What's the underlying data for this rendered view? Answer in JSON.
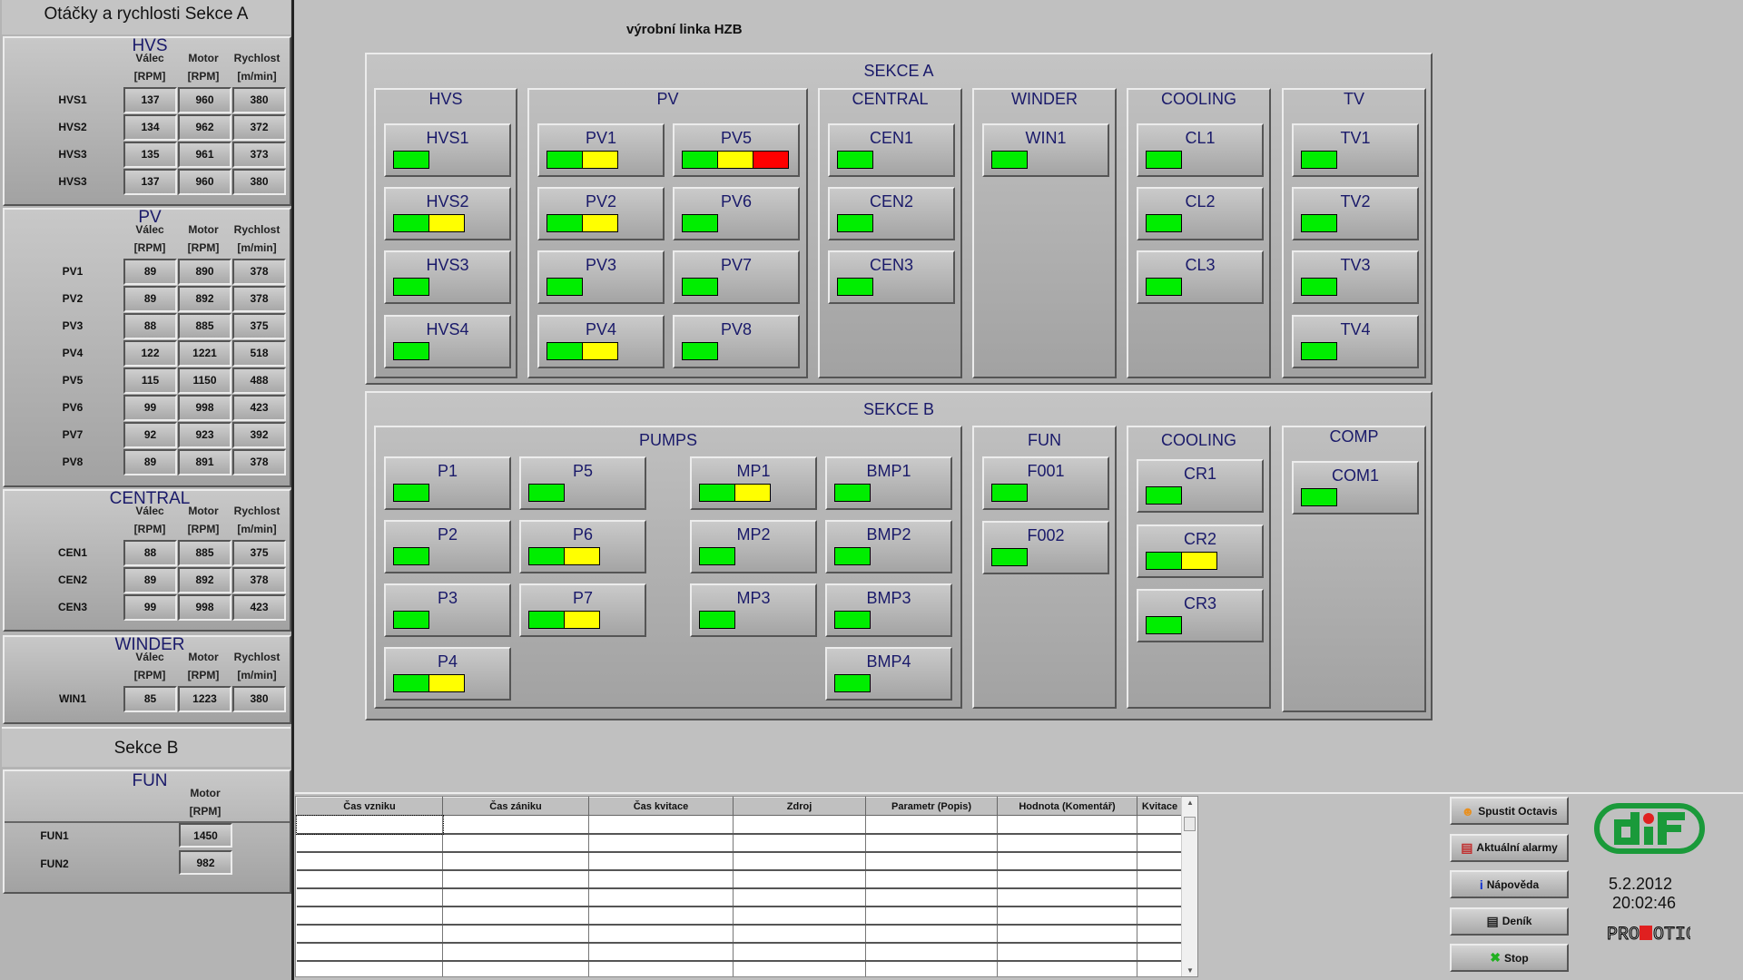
{
  "left_panel": {
    "title": "Otáčky a rychlosti Sekce A",
    "headers": {
      "valec": [
        "Válec",
        "[RPM]"
      ],
      "motor": [
        "Motor",
        "[RPM]"
      ],
      "rychlost": [
        "Rychlost",
        "[m/min]"
      ]
    },
    "sections": [
      {
        "title": "HVS",
        "rows": [
          {
            "name": "HVS1",
            "valec": "137",
            "motor": "960",
            "rychlost": "380"
          },
          {
            "name": "HVS2",
            "valec": "134",
            "motor": "962",
            "rychlost": "372"
          },
          {
            "name": "HVS3",
            "valec": "135",
            "motor": "961",
            "rychlost": "373"
          },
          {
            "name": "HVS3",
            "valec": "137",
            "motor": "960",
            "rychlost": "380"
          }
        ]
      },
      {
        "title": "PV",
        "rows": [
          {
            "name": "PV1",
            "valec": "89",
            "motor": "890",
            "rychlost": "378"
          },
          {
            "name": "PV2",
            "valec": "89",
            "motor": "892",
            "rychlost": "378"
          },
          {
            "name": "PV3",
            "valec": "88",
            "motor": "885",
            "rychlost": "375"
          },
          {
            "name": "PV4",
            "valec": "122",
            "motor": "1221",
            "rychlost": "518"
          },
          {
            "name": "PV5",
            "valec": "115",
            "motor": "1150",
            "rychlost": "488"
          },
          {
            "name": "PV6",
            "valec": "99",
            "motor": "998",
            "rychlost": "423"
          },
          {
            "name": "PV7",
            "valec": "92",
            "motor": "923",
            "rychlost": "392"
          },
          {
            "name": "PV8",
            "valec": "89",
            "motor": "891",
            "rychlost": "378"
          }
        ]
      },
      {
        "title": "CENTRAL",
        "rows": [
          {
            "name": "CEN1",
            "valec": "88",
            "motor": "885",
            "rychlost": "375"
          },
          {
            "name": "CEN2",
            "valec": "89",
            "motor": "892",
            "rychlost": "378"
          },
          {
            "name": "CEN3",
            "valec": "99",
            "motor": "998",
            "rychlost": "423"
          }
        ]
      },
      {
        "title": "WINDER",
        "rows": [
          {
            "name": "WIN1",
            "valec": "85",
            "motor": "1223",
            "rychlost": "380"
          }
        ]
      }
    ],
    "sekce_b_title": "Sekce B",
    "fun": {
      "title": "FUN",
      "header": [
        "Motor",
        "[RPM]"
      ],
      "rows": [
        {
          "name": "FUN1",
          "motor": "1450"
        },
        {
          "name": "FUN2",
          "motor": "982"
        }
      ]
    }
  },
  "main": {
    "title": "výrobní linka HZB",
    "status_colors": {
      "g": "#00ee00",
      "y": "#ffff00",
      "r": "#ff0000"
    },
    "sekce": [
      {
        "title": "SEKCE A",
        "groups": [
          {
            "title": "HVS",
            "columns": [
              [
                {
                  "label": "HVS1",
                  "status": [
                    "g"
                  ]
                },
                {
                  "label": "HVS2",
                  "status": [
                    "g",
                    "y"
                  ]
                },
                {
                  "label": "HVS3",
                  "status": [
                    "g"
                  ]
                },
                {
                  "label": "HVS4",
                  "status": [
                    "g"
                  ]
                }
              ]
            ]
          },
          {
            "title": "PV",
            "columns": [
              [
                {
                  "label": "PV1",
                  "status": [
                    "g",
                    "y"
                  ]
                },
                {
                  "label": "PV2",
                  "status": [
                    "g",
                    "y"
                  ]
                },
                {
                  "label": "PV3",
                  "status": [
                    "g"
                  ]
                },
                {
                  "label": "PV4",
                  "status": [
                    "g",
                    "y"
                  ]
                }
              ],
              [
                {
                  "label": "PV5",
                  "status": [
                    "g",
                    "y",
                    "r"
                  ]
                },
                {
                  "label": "PV6",
                  "status": [
                    "g"
                  ]
                },
                {
                  "label": "PV7",
                  "status": [
                    "g"
                  ]
                },
                {
                  "label": "PV8",
                  "status": [
                    "g"
                  ]
                }
              ]
            ]
          },
          {
            "title": "CENTRAL",
            "columns": [
              [
                {
                  "label": "CEN1",
                  "status": [
                    "g"
                  ]
                },
                {
                  "label": "CEN2",
                  "status": [
                    "g"
                  ]
                },
                {
                  "label": "CEN3",
                  "status": [
                    "g"
                  ]
                }
              ]
            ]
          },
          {
            "title": "WINDER",
            "columns": [
              [
                {
                  "label": "WIN1",
                  "status": [
                    "g"
                  ]
                }
              ]
            ]
          },
          {
            "title": "COOLING",
            "columns": [
              [
                {
                  "label": "CL1",
                  "status": [
                    "g"
                  ]
                },
                {
                  "label": "CL2",
                  "status": [
                    "g"
                  ]
                },
                {
                  "label": "CL3",
                  "status": [
                    "g"
                  ]
                }
              ]
            ]
          },
          {
            "title": "TV",
            "columns": [
              [
                {
                  "label": "TV1",
                  "status": [
                    "g"
                  ]
                },
                {
                  "label": "TV2",
                  "status": [
                    "g"
                  ]
                },
                {
                  "label": "TV3",
                  "status": [
                    "g"
                  ]
                },
                {
                  "label": "TV4",
                  "status": [
                    "g"
                  ]
                }
              ]
            ]
          }
        ]
      },
      {
        "title": "SEKCE B",
        "groups": [
          {
            "title": "PUMPS",
            "columns": [
              [
                {
                  "label": "P1",
                  "status": [
                    "g"
                  ]
                },
                {
                  "label": "P2",
                  "status": [
                    "g"
                  ]
                },
                {
                  "label": "P3",
                  "status": [
                    "g"
                  ]
                },
                {
                  "label": "P4",
                  "status": [
                    "g",
                    "y"
                  ]
                }
              ],
              [
                {
                  "label": "P5",
                  "status": [
                    "g"
                  ]
                },
                {
                  "label": "P6",
                  "status": [
                    "g",
                    "y"
                  ]
                },
                {
                  "label": "P7",
                  "status": [
                    "g",
                    "y"
                  ]
                }
              ],
              [
                {
                  "label": "MP1",
                  "status": [
                    "g",
                    "y"
                  ]
                },
                {
                  "label": "MP2",
                  "status": [
                    "g"
                  ]
                },
                {
                  "label": "MP3",
                  "status": [
                    "g"
                  ]
                }
              ],
              [
                {
                  "label": "BMP1",
                  "status": [
                    "g"
                  ]
                },
                {
                  "label": "BMP2",
                  "status": [
                    "g"
                  ]
                },
                {
                  "label": "BMP3",
                  "status": [
                    "g"
                  ]
                },
                {
                  "label": "BMP4",
                  "status": [
                    "g"
                  ]
                }
              ]
            ]
          },
          {
            "title": "FUN",
            "columns": [
              [
                {
                  "label": "F001",
                  "status": [
                    "g"
                  ]
                },
                {
                  "label": "F002",
                  "status": [
                    "g"
                  ]
                }
              ]
            ]
          },
          {
            "title": "COOLING",
            "columns": [
              [
                {
                  "label": "CR1",
                  "status": [
                    "g"
                  ]
                },
                {
                  "label": "CR2",
                  "status": [
                    "g",
                    "y"
                  ]
                },
                {
                  "label": "CR3",
                  "status": [
                    "g"
                  ]
                }
              ]
            ]
          },
          {
            "title": "COMP",
            "columns": [
              [
                {
                  "label": "COM1",
                  "status": [
                    "g"
                  ]
                }
              ]
            ]
          }
        ]
      }
    ]
  },
  "alarms": {
    "columns": [
      "Čas vzniku",
      "Čas zániku",
      "Čas kvitace",
      "Zdroj",
      "Parametr (Popis)",
      "Hodnota (Komentář)",
      "Kvitace"
    ],
    "rows": []
  },
  "actions": [
    {
      "label": "Spustit Octavis",
      "icon": "octavis-icon"
    },
    {
      "label": "Aktuální alarmy",
      "icon": "alarms-icon"
    },
    {
      "label": "Nápověda",
      "icon": "info-icon"
    },
    {
      "label": "Deník",
      "icon": "log-icon"
    },
    {
      "label": "Stop",
      "icon": "stop-x-icon"
    }
  ],
  "status": {
    "date": "5.2.2012",
    "time": "20:02:46"
  },
  "logos": {
    "company": "dif",
    "software": "PROMOTIC"
  },
  "colors": {
    "logo_green": "#1a9a3a",
    "logo_dot": "#e02020",
    "text_navy": "#1a1a6a"
  }
}
